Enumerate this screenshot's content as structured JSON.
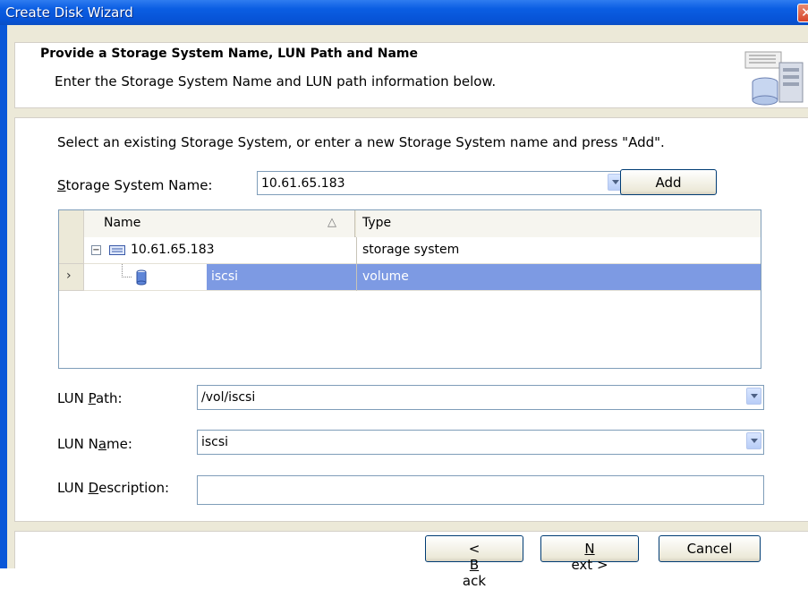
{
  "window": {
    "title": "Create Disk Wizard"
  },
  "header": {
    "title": "Provide a Storage System Name, LUN Path and Name",
    "subtitle": "Enter the Storage System Name and LUN path information below."
  },
  "main": {
    "instruction": "Select an existing Storage System, or enter a new Storage System name and press \"Add\".",
    "storage_system": {
      "label_accel": "S",
      "label_rest": "torage System Name:",
      "value": "10.61.65.183",
      "add_label": "Add"
    },
    "grid": {
      "columns": [
        "Name",
        "Type"
      ],
      "rows": [
        {
          "name": "10.61.65.183",
          "type": "storage system"
        },
        {
          "name": "iscsi",
          "type": "volume"
        }
      ]
    },
    "lun_path": {
      "label_pre": "LUN ",
      "label_accel": "P",
      "label_rest": "ath:",
      "value": "/vol/iscsi"
    },
    "lun_name": {
      "label_pre": "LUN N",
      "label_accel": "a",
      "label_rest": "me:",
      "value": "iscsi"
    },
    "lun_description": {
      "label_pre": "LUN ",
      "label_accel": "D",
      "label_rest": "escription:",
      "value": ""
    }
  },
  "footer": {
    "back": {
      "pre": "< ",
      "accel": "B",
      "rest": "ack"
    },
    "next": {
      "pre": "",
      "accel": "N",
      "rest": "ext >"
    },
    "cancel": "Cancel"
  }
}
